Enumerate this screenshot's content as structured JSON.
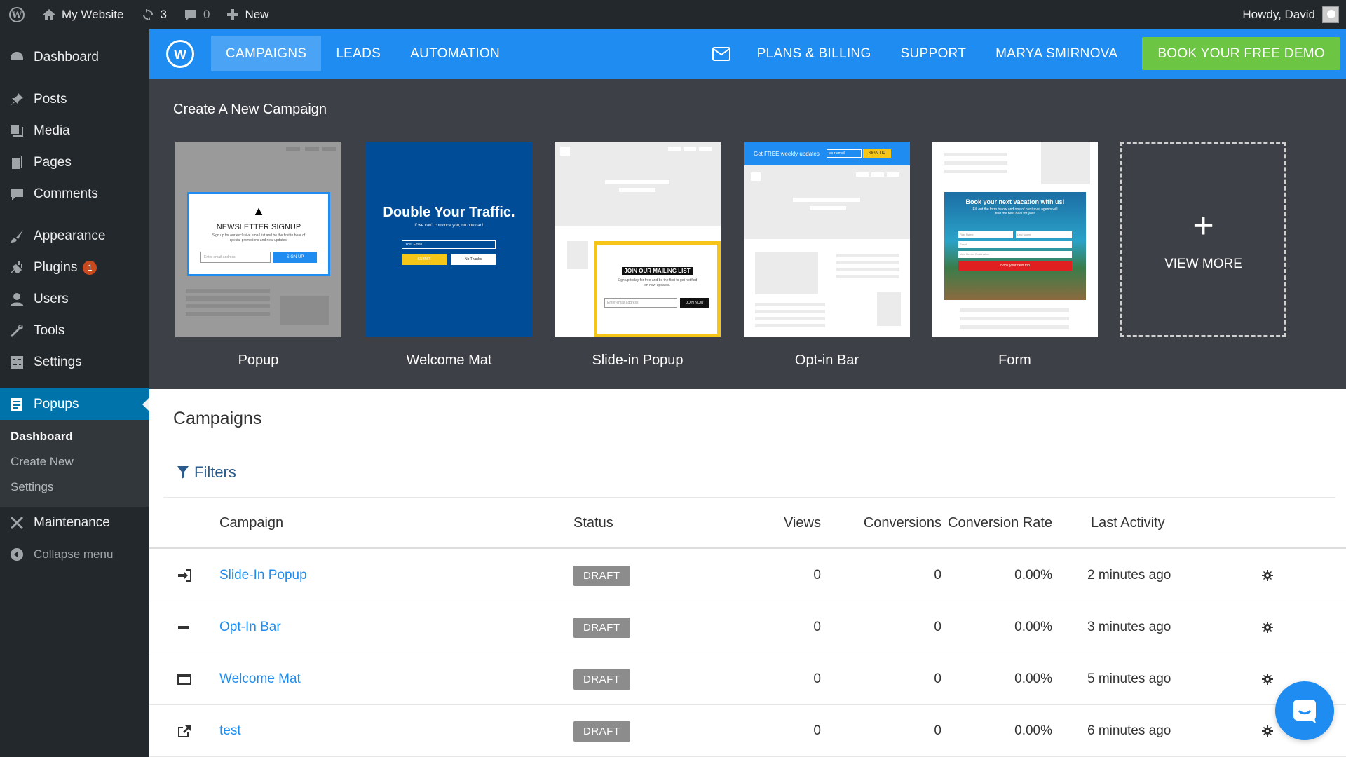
{
  "adminbar": {
    "site_name": "My Website",
    "updates_count": "3",
    "comments_count": "0",
    "new_label": "New",
    "howdy": "Howdy, David"
  },
  "sidebar": {
    "items": [
      {
        "label": "Dashboard",
        "icon": "dashboard-icon"
      },
      {
        "label": "Posts",
        "icon": "pin-icon"
      },
      {
        "label": "Media",
        "icon": "media-icon"
      },
      {
        "label": "Pages",
        "icon": "pages-icon"
      },
      {
        "label": "Comments",
        "icon": "comment-icon"
      },
      {
        "label": "Appearance",
        "icon": "brush-icon"
      },
      {
        "label": "Plugins",
        "icon": "plug-icon",
        "badge": "1"
      },
      {
        "label": "Users",
        "icon": "user-icon"
      },
      {
        "label": "Tools",
        "icon": "wrench-icon"
      },
      {
        "label": "Settings",
        "icon": "settings-icon"
      },
      {
        "label": "Popups",
        "icon": "popup-icon"
      },
      {
        "label": "Maintenance",
        "icon": "tools-icon"
      },
      {
        "label": "Collapse menu",
        "icon": "collapse-icon"
      }
    ],
    "submenu": [
      "Dashboard",
      "Create New",
      "Settings"
    ]
  },
  "appbar": {
    "logo_letter": "w",
    "nav": [
      "CAMPAIGNS",
      "LEADS",
      "AUTOMATION"
    ],
    "right": [
      "PLANS & BILLING",
      "SUPPORT",
      "MARYA SMIRNOVA"
    ],
    "demo_button": "BOOK YOUR FREE DEMO"
  },
  "create": {
    "title": "Create A New Campaign",
    "tiles": [
      "Popup",
      "Welcome Mat",
      "Slide-in Popup",
      "Opt-in Bar",
      "Form"
    ],
    "view_more": "VIEW MORE",
    "thumb_text": {
      "popup_title": "NEWSLETTER SIGNUP",
      "popup_body": "Sign up for our exclusive email list and be the first to hear of special promotions and new updates.",
      "popup_input": "Enter email address",
      "popup_button": "SIGN UP",
      "mat_title": "Double Your Traffic.",
      "mat_sub": "If we can't convince you, no one can!",
      "mat_input": "Your Email",
      "mat_submit": "SUBMIT",
      "mat_no": "No Thanks",
      "slide_title": "JOIN OUR MAILING LIST",
      "slide_body": "Sign up today for free and be the first to get notified on new updates.",
      "slide_input": "Enter email address",
      "slide_button": "JOIN NOW",
      "bar_text": "Get FREE weekly updates",
      "bar_input": "your email",
      "bar_button": "SIGN UP",
      "form_title": "Book your next vacation with us!",
      "form_body": "Fill out the form below and one of our travel agents will find the best deal for you!",
      "form_first": "First Name",
      "form_last": "Last Name",
      "form_email": "Email",
      "form_dest": "Your Dream Destination",
      "form_button": "Book your next trip"
    }
  },
  "campaigns": {
    "title": "Campaigns",
    "filters_label": "Filters",
    "columns": [
      "Campaign",
      "Status",
      "Views",
      "Conversions",
      "Conversion Rate",
      "Last Activity"
    ],
    "rows": [
      {
        "icon": "sign-in-icon",
        "name": "Slide-In Popup",
        "status": "DRAFT",
        "views": "0",
        "conversions": "0",
        "rate": "0.00%",
        "activity": "2 minutes ago"
      },
      {
        "icon": "minus-icon",
        "name": "Opt-In Bar",
        "status": "DRAFT",
        "views": "0",
        "conversions": "0",
        "rate": "0.00%",
        "activity": "3 minutes ago"
      },
      {
        "icon": "window-icon",
        "name": "Welcome Mat",
        "status": "DRAFT",
        "views": "0",
        "conversions": "0",
        "rate": "0.00%",
        "activity": "5 minutes ago"
      },
      {
        "icon": "external-link-icon",
        "name": "test",
        "status": "DRAFT",
        "views": "0",
        "conversions": "0",
        "rate": "0.00%",
        "activity": "6 minutes ago"
      }
    ]
  },
  "colors": {
    "primary": "#1e8cf0",
    "demo_green": "#6cc644",
    "wp_dark": "#23282d",
    "wp_active": "#0073aa",
    "panel": "#3d4147"
  }
}
